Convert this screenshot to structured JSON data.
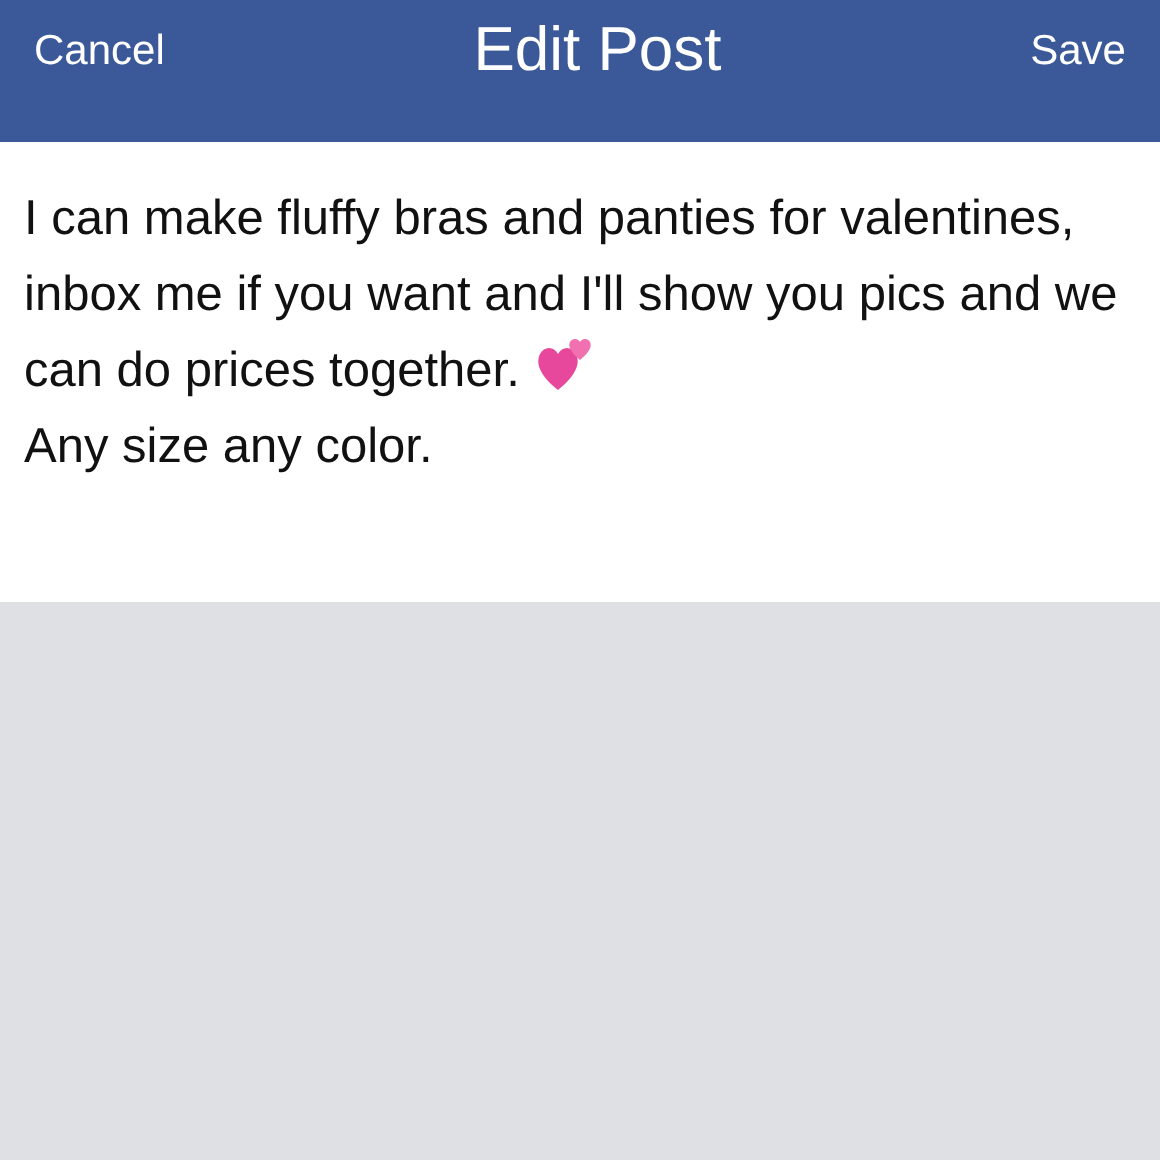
{
  "header": {
    "cancel": "Cancel",
    "title": "Edit Post",
    "save": "Save"
  },
  "post": {
    "text": "I can make fluffy bras and panties for valentines, inbox me if you want and I'll show you pics and we can do prices together.",
    "after_icon": "Any size any color."
  }
}
